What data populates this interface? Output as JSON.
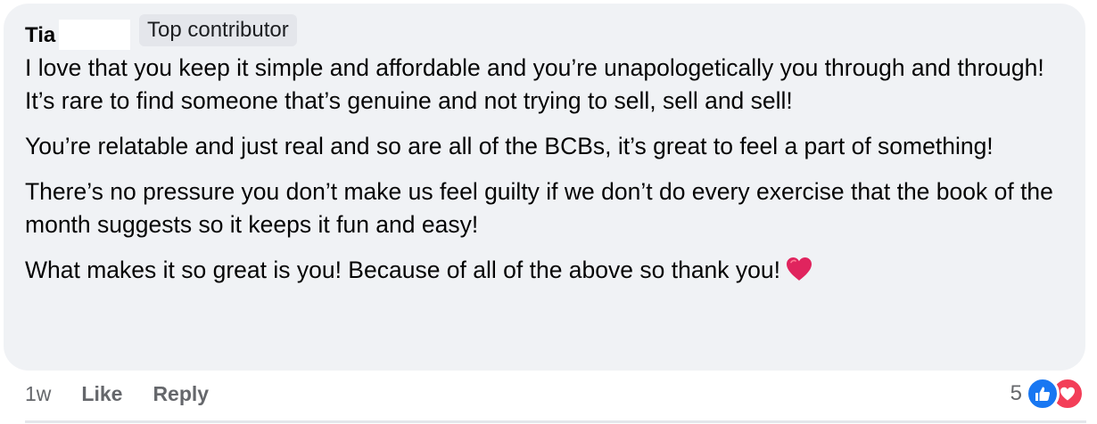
{
  "comment": {
    "author": "Tia",
    "badge": "Top contributor",
    "paragraphs": [
      "I love that you keep it simple and affordable and you’re unapologetically you through and through! It’s rare to find someone that’s genuine and not trying to sell, sell and sell!",
      "You’re relatable and just real and so are all of the BCBs, it’s great to feel a part of something!",
      "There’s no pressure you don’t make us feel guilty if we don’t do every exercise that the book of the month suggests so it keeps it fun and easy!",
      "What makes it so great is you! Because of all of the above so thank you!"
    ],
    "emoji": "red-heart-icon"
  },
  "actions": {
    "time": "1w",
    "like_label": "Like",
    "reply_label": "Reply"
  },
  "reactions": {
    "count": "5",
    "icons": [
      "like-reaction-icon",
      "love-reaction-icon"
    ]
  },
  "colors": {
    "bubble_bg": "#f0f2f5",
    "badge_bg": "#e4e6eb",
    "like_blue": "#1877f2",
    "love_red": "#f33e58",
    "heart_red": "#e0245e",
    "meta_gray": "#65676b"
  }
}
